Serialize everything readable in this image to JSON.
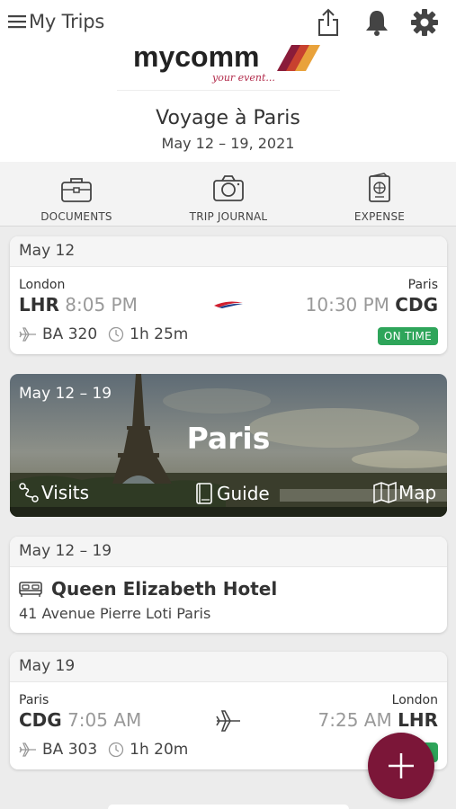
{
  "header": {
    "title": "My Trips",
    "logo_text": "mycomm",
    "logo_tagline": "your event..."
  },
  "trip": {
    "title": "Voyage à Paris",
    "dates": "May 12 – 19, 2021"
  },
  "toolbar": {
    "items": [
      {
        "label": "DOCUMENTS",
        "icon": "briefcase-icon"
      },
      {
        "label": "TRIP JOURNAL",
        "icon": "camera-icon"
      },
      {
        "label": "EXPENSE",
        "icon": "passport-icon"
      }
    ]
  },
  "flight1": {
    "date": "May 12",
    "from_city": "London",
    "from_code": "LHR",
    "dep_time": "8:05 PM",
    "to_city": "Paris",
    "to_code": "CDG",
    "arr_time": "10:30 PM",
    "flight_no": "BA 320",
    "duration": "1h 25m",
    "status": "ON TIME"
  },
  "destination": {
    "dates": "May 12 – 19",
    "city": "Paris",
    "actions": {
      "visits": "Visits",
      "guide": "Guide",
      "map": "Map"
    }
  },
  "hotel": {
    "dates": "May 12 – 19",
    "name": "Queen Elizabeth Hotel",
    "address": "41 Avenue Pierre Loti Paris"
  },
  "flight2": {
    "date": "May 19",
    "from_city": "Paris",
    "from_code": "CDG",
    "dep_time": "7:05 AM",
    "to_city": "London",
    "to_code": "LHR",
    "arr_time": "7:25 AM",
    "flight_no": "BA 303",
    "duration": "1h 20m"
  },
  "colors": {
    "accent": "#7b1638",
    "status_green": "#2ea55a"
  }
}
